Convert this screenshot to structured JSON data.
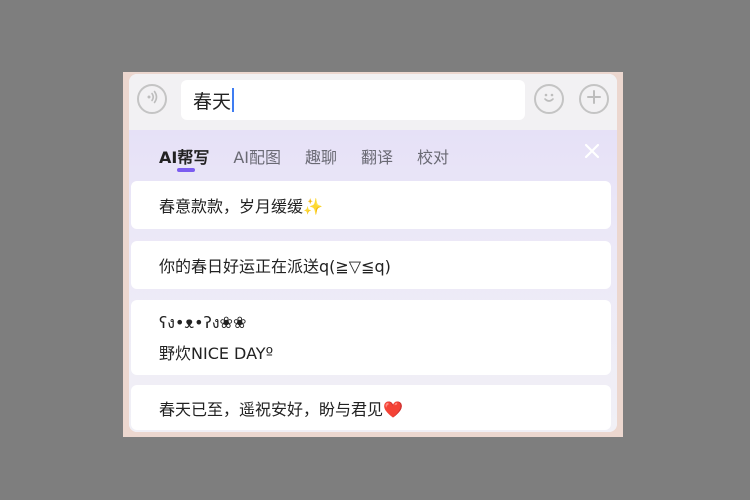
{
  "input": {
    "text": "春天"
  },
  "icons": {
    "voice": "voice-icon",
    "emoji": "smiley-icon",
    "add": "plus-icon",
    "close": "close-icon"
  },
  "tabs": [
    {
      "label": "AI帮写",
      "active": true
    },
    {
      "label": "AI配图",
      "active": false
    },
    {
      "label": "趣聊",
      "active": false
    },
    {
      "label": "翻译",
      "active": false
    },
    {
      "label": "校对",
      "active": false
    }
  ],
  "suggestions": [
    {
      "lines": [
        "春意款款，岁月缓缓✨"
      ]
    },
    {
      "lines": [
        "你的春日好运正在派送q(≧▽≦q)"
      ]
    },
    {
      "lines": [
        "ʕง•ᴥ•ʔง❀❀",
        "野炊NICE DAYº"
      ]
    },
    {
      "lines": [
        "春天已至，遥祝安好，盼与君见❤️"
      ]
    }
  ],
  "colors": {
    "accent": "#7b5cf0",
    "caret": "#3f7df2",
    "frame": "#ecd7cf",
    "backdrop": "#7e7e7e"
  }
}
